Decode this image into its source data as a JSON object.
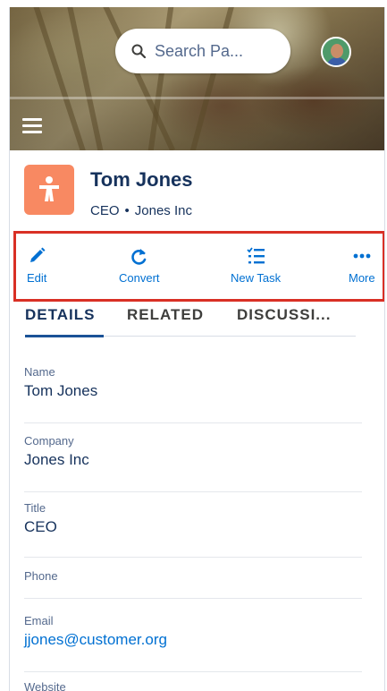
{
  "search": {
    "placeholder": "Search Pa..."
  },
  "record": {
    "name": "Tom Jones",
    "title": "CEO",
    "separator": "•",
    "company": "Jones Inc",
    "icon_color": "#f88962"
  },
  "actions": [
    {
      "label": "Edit",
      "icon": "pencil-icon"
    },
    {
      "label": "Convert",
      "icon": "redo-arrow-icon"
    },
    {
      "label": "New Task",
      "icon": "task-list-icon"
    },
    {
      "label": "More",
      "icon": "more-dots-icon"
    }
  ],
  "tabs": [
    {
      "label": "DETAILS",
      "active": true
    },
    {
      "label": "RELATED",
      "active": false
    },
    {
      "label": "DISCUSSI...",
      "active": false
    }
  ],
  "fields": [
    {
      "label": "Name",
      "value": "Tom Jones"
    },
    {
      "label": "Company",
      "value": "Jones Inc"
    },
    {
      "label": "Title",
      "value": "CEO"
    },
    {
      "label": "Phone",
      "value": ""
    },
    {
      "label": "Email",
      "value": "jjones@customer.org"
    },
    {
      "label": "Website",
      "value": ""
    }
  ],
  "colors": {
    "accent": "#0070d2",
    "highlight_border": "#d93025",
    "text": "#16325c"
  }
}
